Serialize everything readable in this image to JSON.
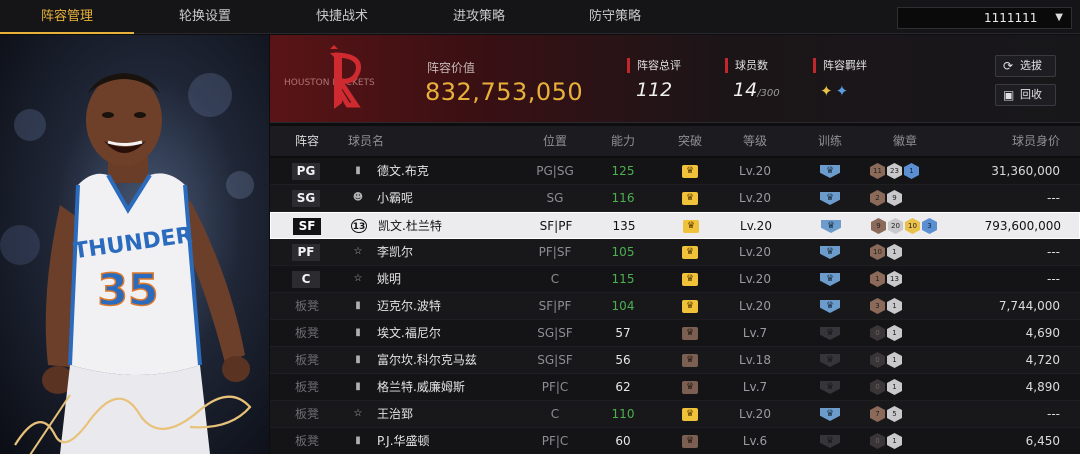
{
  "nav": {
    "tabs": [
      "阵容管理",
      "轮换设置",
      "快捷战术",
      "进攻策略",
      "防守策略"
    ],
    "active_tab": "阵容管理",
    "account": "1111111"
  },
  "team": {
    "logo_text": "HOUSTON ROCKETS",
    "value_label": "阵容价值",
    "value": "832,753,050",
    "rating_label": "阵容总评",
    "rating": "112",
    "players_label": "球员数",
    "players": "14",
    "players_max": "/300",
    "bond_label": "阵容羁绊",
    "btn_draft": "选拔",
    "btn_recycle": "回收"
  },
  "table": {
    "headers": [
      "阵容",
      "球员名",
      "位置",
      "能力",
      "突破",
      "等级",
      "训练",
      "徽章",
      "球员身价"
    ],
    "rows": [
      {
        "slot": "PG",
        "starter": true,
        "icon": "bars",
        "name": "德文.布克",
        "pos": "PG|SG",
        "ability": "125",
        "ability_color": "green",
        "breakthrough": "gold",
        "level": "Lv.20",
        "train": "blue",
        "badges": [
          {
            "t": "bronze",
            "n": "11"
          },
          {
            "t": "silver",
            "n": "23"
          },
          {
            "t": "blue",
            "n": "1"
          }
        ],
        "worth": "31,360,000"
      },
      {
        "slot": "SG",
        "starter": true,
        "icon": "person",
        "name": "小霸呢",
        "pos": "SG",
        "ability": "116",
        "ability_color": "green",
        "breakthrough": "gold",
        "level": "Lv.20",
        "train": "blue",
        "badges": [
          {
            "t": "bronze",
            "n": "2"
          },
          {
            "t": "silver",
            "n": "9"
          }
        ],
        "worth": "---"
      },
      {
        "slot": "SF",
        "starter": true,
        "selected": true,
        "icon": "13",
        "name": "凯文.杜兰特",
        "pos": "SF|PF",
        "ability": "135",
        "ability_color": "white",
        "breakthrough": "gold",
        "level": "Lv.20",
        "train": "blue",
        "badges": [
          {
            "t": "bronze",
            "n": "9"
          },
          {
            "t": "silver",
            "n": "20"
          },
          {
            "t": "gold",
            "n": "10"
          },
          {
            "t": "blue",
            "n": "3"
          }
        ],
        "worth": "793,600,000"
      },
      {
        "slot": "PF",
        "starter": true,
        "icon": "star",
        "name": "李凯尔",
        "pos": "PF|SF",
        "ability": "105",
        "ability_color": "green",
        "breakthrough": "gold",
        "level": "Lv.20",
        "train": "blue",
        "badges": [
          {
            "t": "bronze",
            "n": "10"
          },
          {
            "t": "silver",
            "n": "1"
          }
        ],
        "worth": "---"
      },
      {
        "slot": "C",
        "starter": true,
        "icon": "star",
        "name": "姚明",
        "pos": "C",
        "ability": "115",
        "ability_color": "green",
        "breakthrough": "gold",
        "level": "Lv.20",
        "train": "blue",
        "badges": [
          {
            "t": "bronze",
            "n": "1"
          },
          {
            "t": "silver",
            "n": "13"
          }
        ],
        "worth": "---"
      },
      {
        "slot": "板凳",
        "starter": false,
        "icon": "bars",
        "name": "迈克尔.波特",
        "pos": "SF|PF",
        "ability": "104",
        "ability_color": "green",
        "breakthrough": "gold",
        "level": "Lv.20",
        "train": "blue",
        "badges": [
          {
            "t": "bronze",
            "n": "3"
          },
          {
            "t": "silver",
            "n": "1"
          }
        ],
        "worth": "7,744,000"
      },
      {
        "slot": "板凳",
        "starter": false,
        "icon": "bars",
        "name": "埃文.福尼尔",
        "pos": "SG|SF",
        "ability": "57",
        "ability_color": "white",
        "breakthrough": "brown",
        "level": "Lv.7",
        "train": "dark",
        "badges": [
          {
            "t": "dark",
            "n": "0"
          },
          {
            "t": "silver",
            "n": "1"
          }
        ],
        "worth": "4,690"
      },
      {
        "slot": "板凳",
        "starter": false,
        "icon": "bars",
        "name": "富尔坎.科尔克马兹",
        "pos": "SG|SF",
        "ability": "56",
        "ability_color": "white",
        "breakthrough": "brown",
        "level": "Lv.18",
        "train": "dark",
        "badges": [
          {
            "t": "dark",
            "n": "0"
          },
          {
            "t": "silver",
            "n": "1"
          }
        ],
        "worth": "4,720"
      },
      {
        "slot": "板凳",
        "starter": false,
        "icon": "bars",
        "name": "格兰特.威廉姆斯",
        "pos": "PF|C",
        "ability": "62",
        "ability_color": "white",
        "breakthrough": "brown",
        "level": "Lv.7",
        "train": "dark",
        "badges": [
          {
            "t": "dark",
            "n": "0"
          },
          {
            "t": "silver",
            "n": "1"
          }
        ],
        "worth": "4,890"
      },
      {
        "slot": "板凳",
        "starter": false,
        "icon": "star",
        "name": "王治郅",
        "pos": "C",
        "ability": "110",
        "ability_color": "green",
        "breakthrough": "gold",
        "level": "Lv.20",
        "train": "blue",
        "badges": [
          {
            "t": "bronze",
            "n": "7"
          },
          {
            "t": "silver",
            "n": "5"
          }
        ],
        "worth": "---"
      },
      {
        "slot": "板凳",
        "starter": false,
        "icon": "bars",
        "name": "P.J.华盛顿",
        "pos": "PF|C",
        "ability": "60",
        "ability_color": "white",
        "breakthrough": "brown",
        "level": "Lv.6",
        "train": "dark",
        "badges": [
          {
            "t": "dark",
            "n": "0"
          },
          {
            "t": "silver",
            "n": "1"
          }
        ],
        "worth": "6,450"
      }
    ]
  },
  "portrait": {
    "jersey_team": "THUNDER",
    "jersey_number": "35"
  },
  "colors": {
    "accent": "#e8b23a",
    "ability_green": "#4caf50",
    "team_red": "#c3262b"
  }
}
